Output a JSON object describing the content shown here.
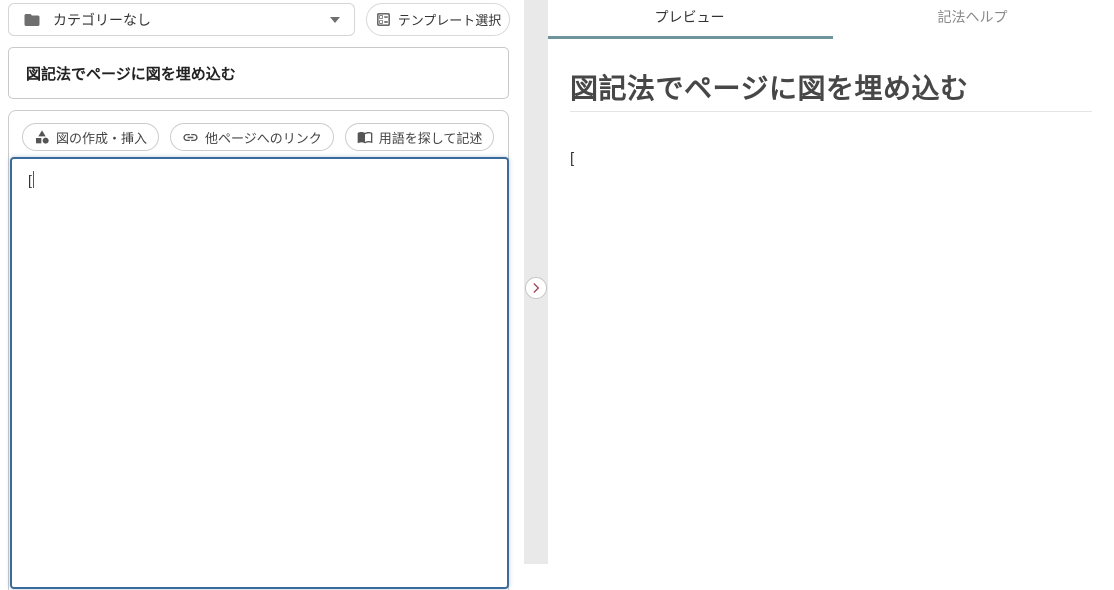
{
  "left_panel": {
    "category_select": {
      "value": "カテゴリーなし"
    },
    "template_button": {
      "label": "テンプレート選択"
    },
    "title_input": {
      "value": "図記法でページに図を埋め込む"
    },
    "toolbar": {
      "buttons": [
        {
          "label": "図の作成・挿入",
          "icon": "shapes-icon"
        },
        {
          "label": "他ページへのリンク",
          "icon": "link-icon"
        },
        {
          "label": "用語を探して記述",
          "icon": "book-icon"
        }
      ]
    },
    "editor": {
      "value": "["
    }
  },
  "divider": {
    "expand_icon": "chevron-right-icon"
  },
  "right_panel": {
    "tabs": [
      {
        "label": "プレビュー",
        "active": true
      },
      {
        "label": "記法ヘルプ",
        "active": false
      }
    ],
    "preview": {
      "heading": "図記法でページに図を埋め込む",
      "body_text": "["
    }
  },
  "colors": {
    "active_tab_underline": "#6e959c",
    "editor_focus_border": "#3b6a9c",
    "divider_chevron": "#9d4a5c",
    "gutter_background": "#e9e9e9"
  }
}
